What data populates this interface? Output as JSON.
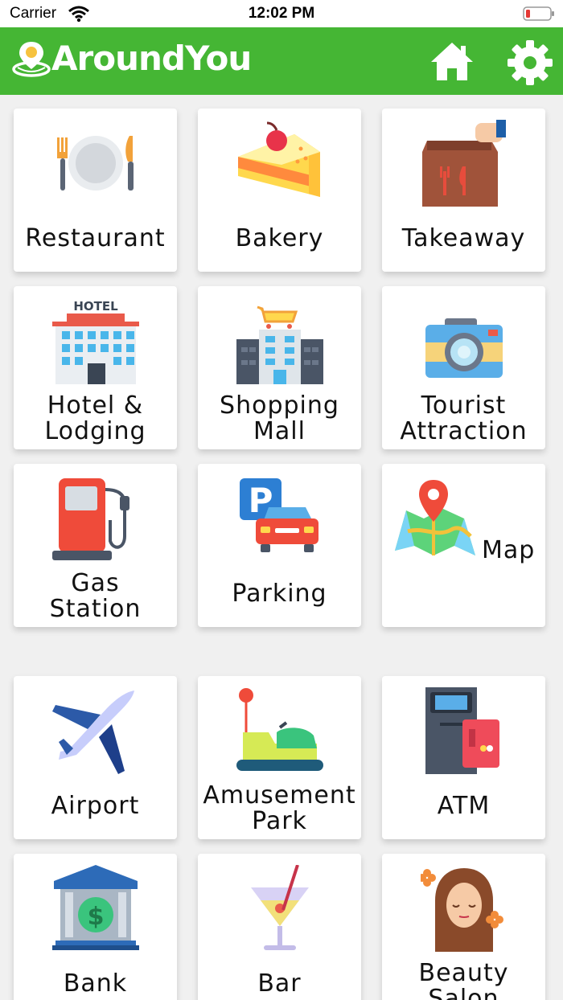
{
  "status_bar": {
    "carrier": "Carrier",
    "time": "12:02 PM"
  },
  "header": {
    "app_name": "AroundYou"
  },
  "categories": [
    {
      "label": "Restaurant"
    },
    {
      "label": "Bakery"
    },
    {
      "label": "Takeaway"
    },
    {
      "label": "Hotel &\nLodging"
    },
    {
      "label": "Shopping\nMall"
    },
    {
      "label": "Tourist\nAttraction"
    },
    {
      "label": "Gas\nStation"
    },
    {
      "label": "Parking"
    },
    {
      "label": "Map"
    },
    {
      "label": "Airport"
    },
    {
      "label": "Amusement\nPark"
    },
    {
      "label": "ATM"
    },
    {
      "label": "Bank"
    },
    {
      "label": "Bar"
    },
    {
      "label": "Beauty\nSalon"
    }
  ],
  "icons": {
    "hotel_sign": "HOTEL",
    "parking_letter": "P",
    "bank_symbol": "$"
  },
  "colors": {
    "header": "#45b634",
    "background": "#f0f0f0"
  }
}
